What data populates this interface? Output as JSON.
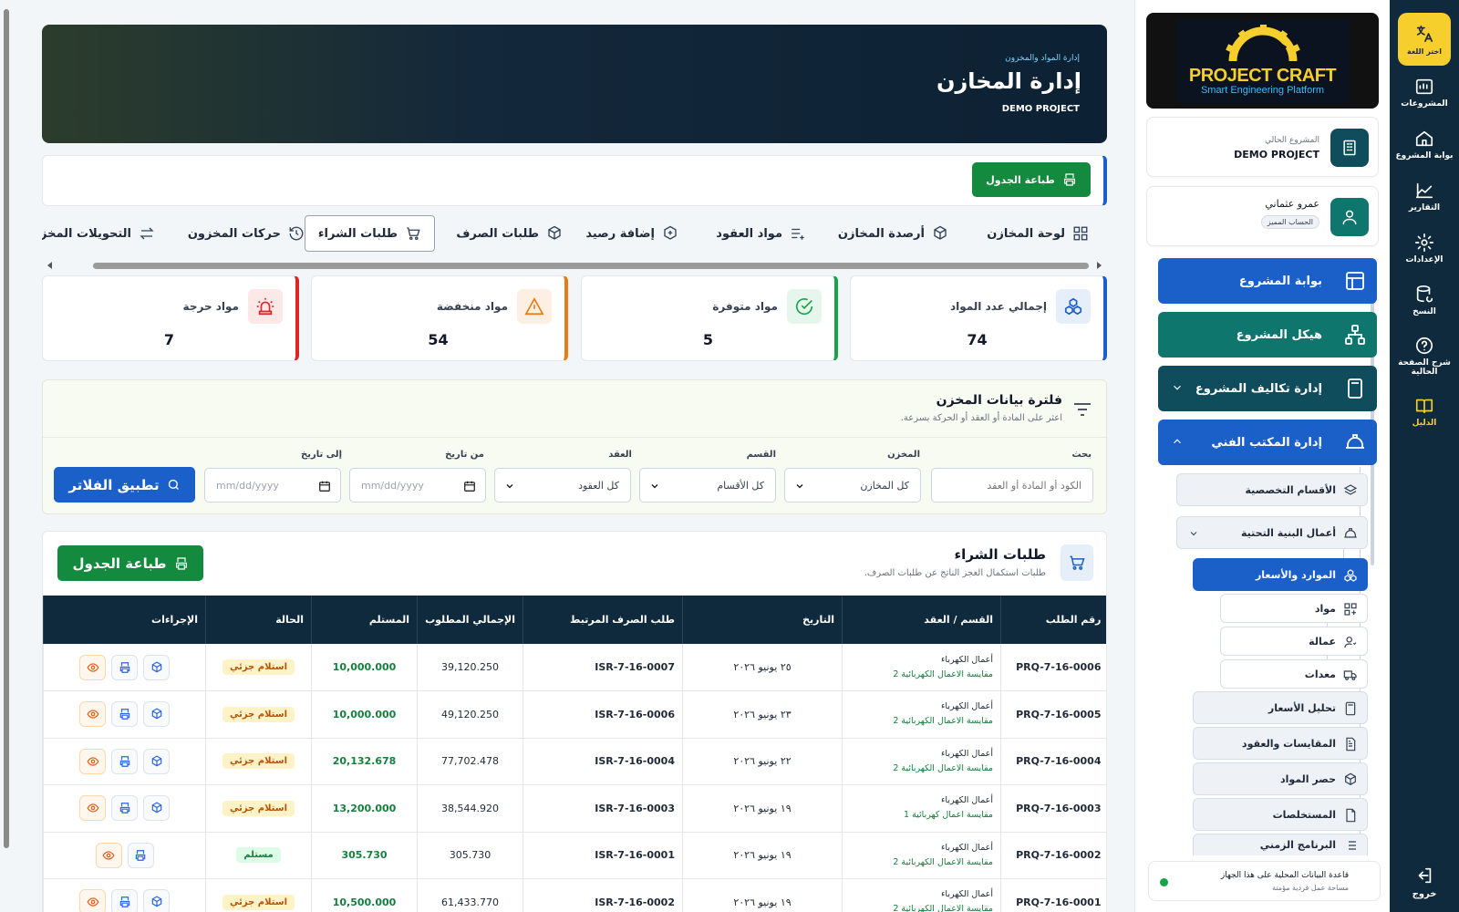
{
  "rail": {
    "lang_label": "اختر اللغة",
    "items": [
      {
        "label": "المشروعات",
        "icon": "projects-icon"
      },
      {
        "label": "بوابة المشروع",
        "icon": "home-icon"
      },
      {
        "label": "التقارير",
        "icon": "reports-icon"
      },
      {
        "label": "الإعدادات",
        "icon": "settings-icon"
      },
      {
        "label": "النسخ",
        "icon": "backup-icon"
      },
      {
        "label": "شرح الصفحة الحالية",
        "icon": "help-icon"
      },
      {
        "label": "الدليل",
        "icon": "guide-icon"
      }
    ],
    "exit_label": "خروج"
  },
  "sidebar": {
    "logo_title": "PROJECT CRAFT",
    "logo_subtitle": "Smart Engineering Platform",
    "current_project_label": "المشروع الحالي",
    "current_project": "DEMO PROJECT",
    "user_name": "عمرو عثماني",
    "user_badge": "الحساب المميز",
    "nav": [
      {
        "label": "بوابة المشروع",
        "color": "#1b5fc8"
      },
      {
        "label": "هيكل المشروع",
        "color": "#0f766e"
      },
      {
        "label": "إدارة تكاليف المشروع",
        "color": "#0f4c5c"
      },
      {
        "label": "إدارة المكتب الفني",
        "color": "#1b5fc8"
      }
    ],
    "sub": {
      "specialized": "الأقسام التخصصية",
      "infrastructure": "أعمال البنية التحتية",
      "resources": "الموارد والأسعار",
      "materials": "مواد",
      "labor": "عمالة",
      "equipment": "معدات",
      "price_analysis": "تحليل الأسعار",
      "contracts": "المقايسات والعقود",
      "takeoff": "حصر المواد",
      "invoices": "المستخلصات",
      "schedule": "البرنامج الزمني"
    },
    "db_title": "قاعدة البيانات المحلية على هذا الجهاز",
    "db_sub": "مساحة عمل فردية مؤمنة"
  },
  "header": {
    "breadcrumb": "إدارة المواد والمخزون",
    "title": "إدارة المخازن",
    "project": "DEMO PROJECT"
  },
  "toolbar": {
    "print_label": "طباعة الجدول"
  },
  "tabs": [
    {
      "label": "لوحة المخازن",
      "icon": "grid-icon"
    },
    {
      "label": "أرصدة المخازن",
      "icon": "boxes-icon"
    },
    {
      "label": "مواد العقود",
      "icon": "list-plus-icon"
    },
    {
      "label": "إضافة رصيد",
      "icon": "box-plus-icon"
    },
    {
      "label": "طلبات الصرف",
      "icon": "box-icon"
    },
    {
      "label": "طلبات الشراء",
      "icon": "cart-icon"
    },
    {
      "label": "حركات المخزون",
      "icon": "history-icon"
    },
    {
      "label": "التحويلات المخز",
      "icon": "transfer-icon"
    }
  ],
  "stats": [
    {
      "label": "إجمالي عدد المواد",
      "value": "74",
      "color": "#1b5fc8"
    },
    {
      "label": "مواد متوفرة",
      "value": "5",
      "color": "#16a34a"
    },
    {
      "label": "مواد منخفضة",
      "value": "54",
      "color": "#ea7a14"
    },
    {
      "label": "مواد حرجة",
      "value": "7",
      "color": "#dc2626"
    }
  ],
  "filter": {
    "title": "فلترة بيانات المخزن",
    "subtitle": "اعثر على المادة أو العقد أو الحركة بسرعة.",
    "search_label": "بحث",
    "search_placeholder": "الكود أو المادة أو العقد",
    "store_label": "المخزن",
    "store_value": "كل المخازن",
    "dept_label": "القسم",
    "dept_value": "كل الأقسام",
    "contract_label": "العقد",
    "contract_value": "كل العقود",
    "from_label": "من تاريخ",
    "from_placeholder": "mm/dd/yyyy",
    "to_label": "إلى تاريخ",
    "to_placeholder": "mm/dd/yyyy",
    "apply_label": "تطبيق الفلاتر"
  },
  "table_section": {
    "title": "طلبات الشراء",
    "subtitle": "طلبات استكمال العجز الناتج عن طلبات الصرف.",
    "print_label": "طباعة الجدول",
    "columns": [
      "رقم الطلب",
      "القسم / العقد",
      "التاريخ",
      "طلب الصرف المرتبط",
      "الإجمالي المطلوب",
      "المستلم",
      "الحالة",
      "الإجراءات"
    ],
    "rows": [
      {
        "id": "PRQ-7-16-0006",
        "dept": "أعمال الكهرباء",
        "contract": "مقايسة الاعمال الكهربائية 2",
        "date": "٢٥ يونيو ٢٠٢٦",
        "isr": "ISR-7-16-0007",
        "total": "39,120.250",
        "received": "10,000.000",
        "status": "استلام جزئي",
        "full": false
      },
      {
        "id": "PRQ-7-16-0005",
        "dept": "أعمال الكهرباء",
        "contract": "مقايسة الاعمال الكهربائية 2",
        "date": "٢٣ يونيو ٢٠٢٦",
        "isr": "ISR-7-16-0006",
        "total": "49,120.250",
        "received": "10,000.000",
        "status": "استلام جزئي",
        "full": false
      },
      {
        "id": "PRQ-7-16-0004",
        "dept": "أعمال الكهرباء",
        "contract": "مقايسة الاعمال الكهربائية 2",
        "date": "٢٢ يونيو ٢٠٢٦",
        "isr": "ISR-7-16-0004",
        "total": "77,702.478",
        "received": "20,132.678",
        "status": "استلام جزئي",
        "full": false
      },
      {
        "id": "PRQ-7-16-0003",
        "dept": "أعمال الكهرباء",
        "contract": "مقايسة اعمال كهربائية 1",
        "date": "١٩ يونيو ٢٠٢٦",
        "isr": "ISR-7-16-0003",
        "total": "38,544.920",
        "received": "13,200.000",
        "status": "استلام جزئي",
        "full": false
      },
      {
        "id": "PRQ-7-16-0002",
        "dept": "أعمال الكهرباء",
        "contract": "مقايسة الاعمال الكهربائية 2",
        "date": "١٩ يونيو ٢٠٢٦",
        "isr": "ISR-7-16-0001",
        "total": "305.730",
        "received": "305.730",
        "status": "مستلم",
        "full": true
      },
      {
        "id": "PRQ-7-16-0001",
        "dept": "أعمال الكهرباء",
        "contract": "مقايسة الاعمال الكهربائية 2",
        "date": "١٩ يونيو ٢٠٢٦",
        "isr": "ISR-7-16-0002",
        "total": "61,433.770",
        "received": "10,500.000",
        "status": "استلام جزئي",
        "full": false
      }
    ]
  }
}
